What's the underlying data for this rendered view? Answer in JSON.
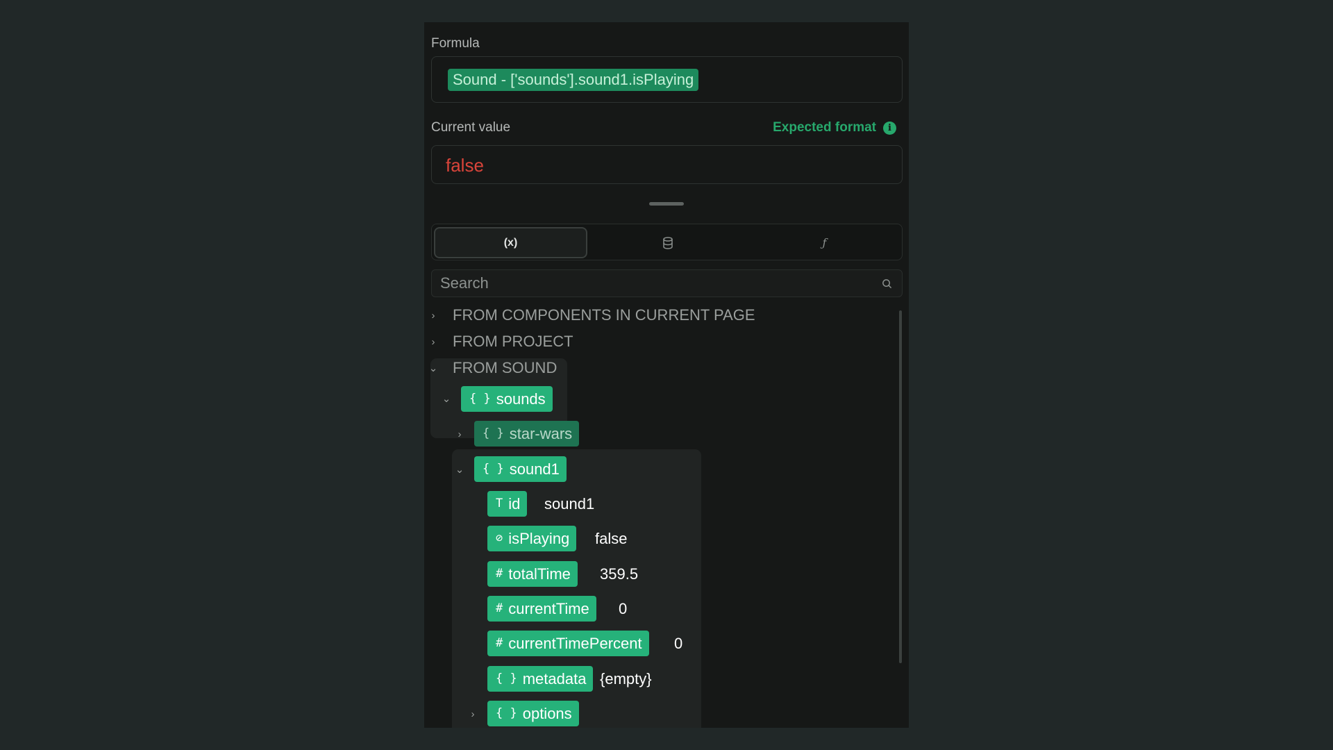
{
  "formula": {
    "label": "Formula",
    "chip": "Sound - ['sounds'].sound1.isPlaying"
  },
  "current_value": {
    "label": "Current value",
    "expected_format": "Expected format",
    "value": "false"
  },
  "tabs": [
    {
      "label": "(x)",
      "icon": "variable-icon",
      "active": true
    },
    {
      "label": "",
      "icon": "database-icon",
      "active": false
    },
    {
      "label": "ƒ",
      "icon": "function-icon",
      "active": false
    }
  ],
  "search": {
    "placeholder": "Search"
  },
  "tree": {
    "components_header": "FROM COMPONENTS IN CURRENT PAGE",
    "project_header": "FROM PROJECT",
    "sound_header": "FROM SOUND",
    "sounds": "sounds",
    "star_wars": "star-wars",
    "sound1": "sound1",
    "fields": [
      {
        "icon": "T",
        "name": "id",
        "value": "sound1"
      },
      {
        "icon": "⊘",
        "name": "isPlaying",
        "value": "false"
      },
      {
        "icon": "#",
        "name": "totalTime",
        "value": "359.5"
      },
      {
        "icon": "#",
        "name": "currentTime",
        "value": "0"
      },
      {
        "icon": "#",
        "name": "currentTimePercent",
        "value": "0"
      },
      {
        "icon": "{ }",
        "name": "metadata",
        "value": "{empty}"
      }
    ],
    "options": "options",
    "object_icon": "{ }"
  },
  "colors": {
    "accent": "#26b27a",
    "false_value": "#d9443a",
    "background": "#212828",
    "panel": "#161817"
  }
}
